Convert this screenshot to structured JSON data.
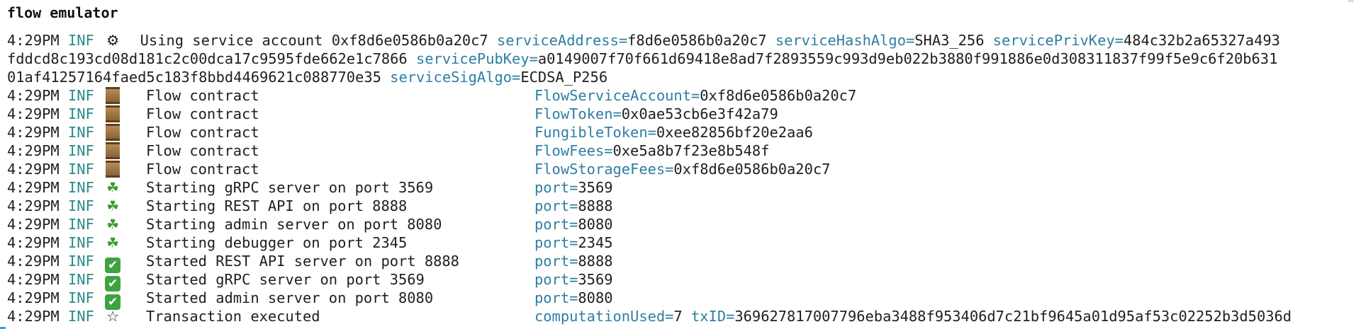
{
  "window": {
    "title": "flow emulator"
  },
  "log": {
    "service_line": {
      "time": "4:29PM",
      "level": "INF",
      "icon": "⚙",
      "message": "Using service account 0xf8d6e0586b0a20c7",
      "fields": [
        {
          "key": "serviceAddress=",
          "value": "f8d6e0586b0a20c7"
        },
        {
          "key": "serviceHashAlgo=",
          "value": "SHA3_256"
        },
        {
          "key": "servicePrivKey=",
          "value": "484c32b2a65327a493"
        }
      ],
      "wrap1_value": "fddcd8c193cd08d181c2c00dca17c9595fde662e1c7866",
      "wrap1_key": "servicePubKey=",
      "wrap1_value2": "a0149007f70f661d69418e8ad7f2893559c993d9eb022b3880f991886e0d308311837f99f5e9c6f20b631",
      "wrap2_value": "01af41257164faed5c183f8bbd4469621c088770e35",
      "wrap2_key": "serviceSigAlgo=",
      "wrap2_value2": "ECDSA_P256"
    },
    "lines": [
      {
        "time": "4:29PM",
        "level": "INF",
        "icon": "crate",
        "message": "Flow contract",
        "fields": [
          {
            "key": "FlowServiceAccount=",
            "value": "0xf8d6e0586b0a20c7"
          }
        ]
      },
      {
        "time": "4:29PM",
        "level": "INF",
        "icon": "crate",
        "message": "Flow contract",
        "fields": [
          {
            "key": "FlowToken=",
            "value": "0x0ae53cb6e3f42a79"
          }
        ]
      },
      {
        "time": "4:29PM",
        "level": "INF",
        "icon": "crate",
        "message": "Flow contract",
        "fields": [
          {
            "key": "FungibleToken=",
            "value": "0xee82856bf20e2aa6"
          }
        ]
      },
      {
        "time": "4:29PM",
        "level": "INF",
        "icon": "crate",
        "message": "Flow contract",
        "fields": [
          {
            "key": "FlowFees=",
            "value": "0xe5a8b7f23e8b548f"
          }
        ]
      },
      {
        "time": "4:29PM",
        "level": "INF",
        "icon": "crate",
        "message": "Flow contract",
        "fields": [
          {
            "key": "FlowStorageFees=",
            "value": "0xf8d6e0586b0a20c7"
          }
        ]
      },
      {
        "time": "4:29PM",
        "level": "INF",
        "icon": "sprout",
        "message": "Starting gRPC server on port 3569",
        "fields": [
          {
            "key": "port=",
            "value": "3569"
          }
        ]
      },
      {
        "time": "4:29PM",
        "level": "INF",
        "icon": "sprout",
        "message": "Starting REST API on port 8888",
        "fields": [
          {
            "key": "port=",
            "value": "8888"
          }
        ]
      },
      {
        "time": "4:29PM",
        "level": "INF",
        "icon": "sprout",
        "message": "Starting admin server on port 8080",
        "fields": [
          {
            "key": "port=",
            "value": "8080"
          }
        ]
      },
      {
        "time": "4:29PM",
        "level": "INF",
        "icon": "sprout",
        "message": "Starting debugger on port 2345",
        "fields": [
          {
            "key": "port=",
            "value": "2345"
          }
        ]
      },
      {
        "time": "4:29PM",
        "level": "INF",
        "icon": "check",
        "message": "Started REST API server on port 8888",
        "fields": [
          {
            "key": "port=",
            "value": "8888"
          }
        ]
      },
      {
        "time": "4:29PM",
        "level": "INF",
        "icon": "check",
        "message": "Started gRPC server on port 3569",
        "fields": [
          {
            "key": "port=",
            "value": "3569"
          }
        ]
      },
      {
        "time": "4:29PM",
        "level": "INF",
        "icon": "check",
        "message": "Started admin server on port 8080",
        "fields": [
          {
            "key": "port=",
            "value": "8080"
          }
        ]
      },
      {
        "time": "4:29PM",
        "level": "INF",
        "icon": "star",
        "message": "Transaction executed",
        "fields": [
          {
            "key": "computationUsed=",
            "value": "7"
          },
          {
            "key": "txID=",
            "value": "369627817007796eba3488f953406d7c21bf9645a01d95af53c02252b3d5036d"
          }
        ]
      }
    ]
  },
  "colors": {
    "level": "#2e8a8a",
    "field_key": "#2e7fa3",
    "cursor": "#2aa9c9"
  }
}
